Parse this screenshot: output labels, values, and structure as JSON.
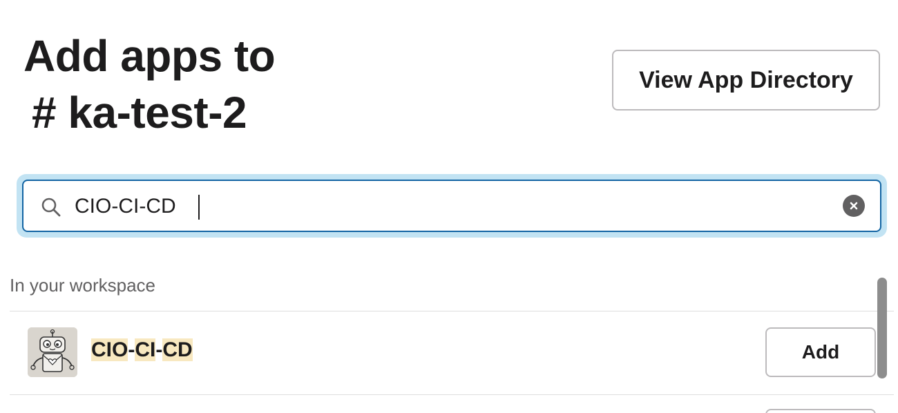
{
  "header": {
    "title_line1": "Add apps to",
    "title_line2": "# ka-test-2",
    "view_directory_label": "View App Directory"
  },
  "search": {
    "value": "CIO-CI-CD",
    "icon": "search-icon",
    "clear_icon": "close-circle-icon",
    "focus_ring_color": "#c2e3f3",
    "border_color": "#1264a3"
  },
  "results": {
    "section_label": "In your workspace",
    "apps": [
      {
        "name_parts": [
          "CIO",
          "-",
          "CI",
          "-",
          "CD"
        ],
        "highlight_color": "#f8e8c0",
        "avatar_icon": "robot-avatar-icon",
        "add_label": "Add"
      }
    ]
  }
}
